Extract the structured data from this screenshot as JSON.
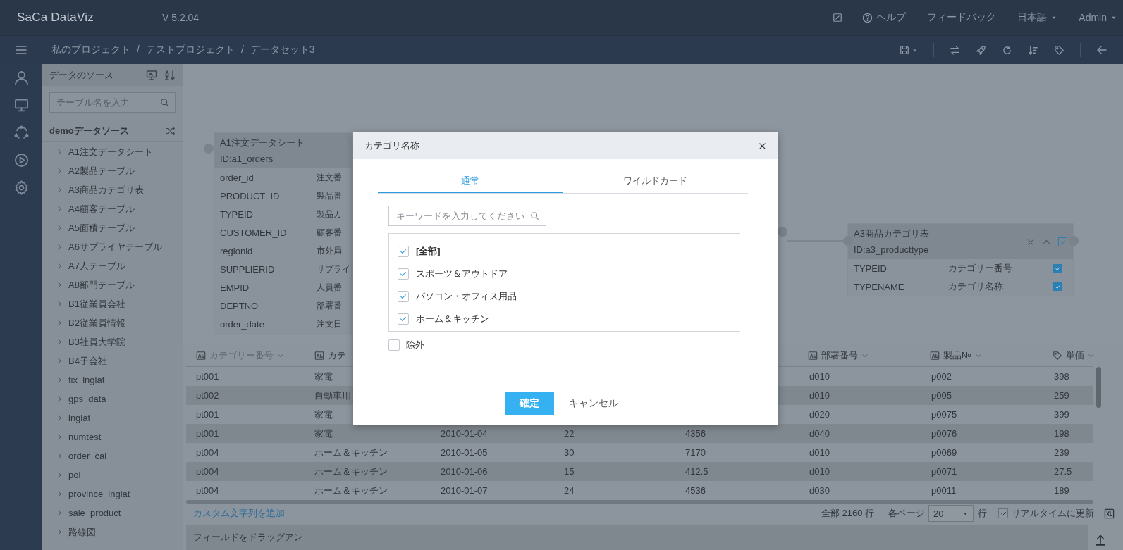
{
  "header": {
    "logo": "SaCa DataViz",
    "version": "V 5.2.04",
    "menu": [
      {
        "label": "ヘルプ",
        "kind": "help"
      },
      {
        "label": "フィードバック",
        "kind": "plain"
      },
      {
        "label": "日本語",
        "kind": "dropdown"
      },
      {
        "label": "Admin",
        "kind": "dropdown"
      }
    ]
  },
  "breadcrumb": [
    "私のプロジェクト",
    "/",
    "テストプロジェクト",
    "/",
    "データセット3"
  ],
  "sidebar": {
    "title": "データのソース",
    "search": {
      "placeholder": "テーブル名を入力"
    },
    "source": "demoデータソース",
    "items": [
      "A1注文データシート",
      "A2製品テーブル",
      "A3商品カテゴリ表",
      "A4顧客テーブル",
      "A5面積テーブル",
      "A6サプライヤテーブル",
      "A7人テーブル",
      "A8部門テーブル",
      "B1従業員会社",
      "B2従業員情報",
      "B3社員大学院",
      "B4子会社",
      "fix_lnglat",
      "gps_data",
      "lnglat",
      "numtest",
      "order_cal",
      "poi",
      "province_lnglat",
      "sale_product",
      "路線図"
    ]
  },
  "cards": [
    {
      "title": "A1注文データシート",
      "id": "ID:a1_orders",
      "fields": [
        {
          "name": "order_id",
          "label": "注文番"
        },
        {
          "name": "PRODUCT_ID",
          "label": "製品番"
        },
        {
          "name": "TYPEID",
          "label": "製品カ"
        },
        {
          "name": "CUSTOMER_ID",
          "label": "顧客番"
        },
        {
          "name": "regionid",
          "label": "市外局"
        },
        {
          "name": "SUPPLIERID",
          "label": "サプライ"
        },
        {
          "name": "EMPID",
          "label": "人員番"
        },
        {
          "name": "DEPTNO",
          "label": "部署番"
        },
        {
          "name": "order_date",
          "label": "注文日"
        }
      ]
    },
    {
      "title": "A3商品カテゴリ表",
      "id": "ID:a3_producttype",
      "checked": true,
      "fields": [
        {
          "name": "TYPEID",
          "label": "カテゴリー番号",
          "checked": true
        },
        {
          "name": "TYPENAME",
          "label": "カテゴリ名称",
          "checked": true
        }
      ]
    }
  ],
  "table": {
    "columns": [
      {
        "label": "カテゴリー番号",
        "kind": "text",
        "menu": true
      },
      {
        "label": "カテ",
        "kind": "text",
        "menu": false
      },
      null,
      null,
      null,
      {
        "label": "部署番号",
        "kind": "text",
        "menu": true
      },
      {
        "label": "製品№",
        "kind": "text",
        "menu": true
      },
      {
        "label": "単価",
        "kind": "number",
        "menu": true
      }
    ],
    "rows": [
      [
        "pt001",
        "家電",
        null,
        null,
        null,
        "d010",
        "p002",
        "398"
      ],
      [
        "pt002",
        "自動車用",
        null,
        null,
        null,
        "d010",
        "p005",
        "259"
      ],
      [
        "pt001",
        "家電",
        null,
        null,
        null,
        "d020",
        "p0075",
        "399"
      ],
      [
        "pt001",
        "家電",
        "2010-01-04",
        "22",
        "4356",
        "d040",
        "p0076",
        "198"
      ],
      [
        "pt004",
        "ホーム＆キッチン",
        "2010-01-05",
        "30",
        "7170",
        "d010",
        "p0069",
        "239"
      ],
      [
        "pt004",
        "ホーム＆キッチン",
        "2010-01-06",
        "15",
        "412.5",
        "d010",
        "p0071",
        "27.5"
      ],
      [
        "pt004",
        "ホーム＆キッチン",
        "2010-01-07",
        "24",
        "4536",
        "d030",
        "p0011",
        "189"
      ]
    ]
  },
  "footer": {
    "add_link": "カスタム文字列を追加",
    "total": "全部 2160 行",
    "per_page_label": "各ページ",
    "per_page": "20",
    "per_page_unit": "行",
    "realtime": {
      "label": "リアルタイムに更新",
      "checked": true
    }
  },
  "drop_zone": {
    "label": "フィールドをドラッグアン"
  },
  "dialog": {
    "title": "カテゴリ名称",
    "tabs": [
      {
        "label": "通常",
        "selected": true
      },
      {
        "label": "ワイルドカード",
        "selected": false
      }
    ],
    "search": {
      "placeholder": "キーワードを入力してください"
    },
    "options": [
      {
        "label": "[全部]",
        "kind": "all",
        "checked": true
      },
      {
        "label": "スポーツ＆アウトドア",
        "kind": "item",
        "checked": true
      },
      {
        "label": "パソコン・オフィス用品",
        "kind": "item",
        "checked": true
      },
      {
        "label": "ホーム＆キッチン",
        "kind": "item",
        "checked": true
      }
    ],
    "exclude": {
      "label": "除外",
      "checked": false
    },
    "buttons": [
      {
        "label": "確定",
        "kind": "primary"
      },
      {
        "label": "キャンセル",
        "kind": "secondary"
      }
    ]
  }
}
